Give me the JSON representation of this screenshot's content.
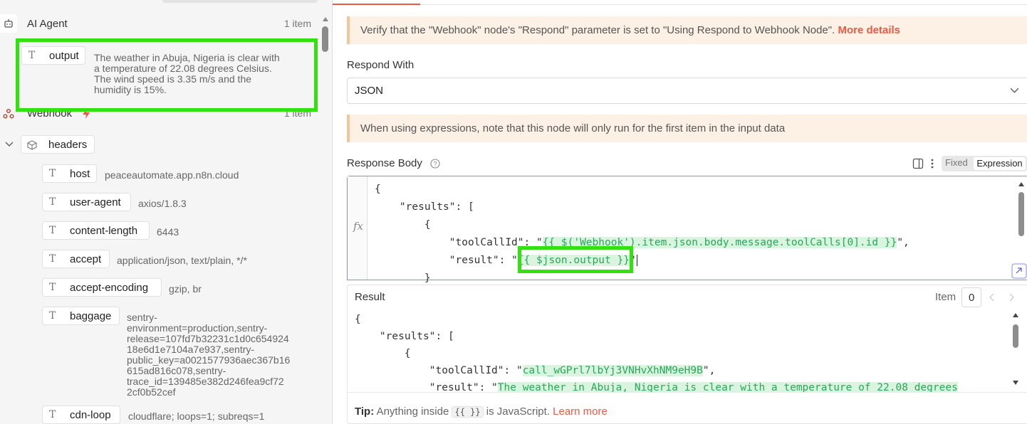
{
  "left_panel": {
    "ai_agent_node": {
      "label": "AI Agent",
      "count": "1 item"
    },
    "output_field": {
      "key": "output",
      "value_lines": [
        "The weather in Abuja, Nigeria is clear with",
        "a temperature of 22.08 degrees Celsius.",
        "The wind speed is 3.35 m/s and the",
        "humidity is 15%."
      ]
    },
    "webhook_node": {
      "label": "Webhook",
      "count": "1 item"
    },
    "headers_field": {
      "key": "headers"
    },
    "header_items": [
      {
        "key": "host",
        "value_lines": [
          "peaceautomate.app.n8n.cloud"
        ]
      },
      {
        "key": "user-agent",
        "value_lines": [
          "axios/1.8.3"
        ]
      },
      {
        "key": "content-length",
        "value_lines": [
          "6443"
        ]
      },
      {
        "key": "accept",
        "value_lines": [
          "application/json, text/plain, */*"
        ]
      },
      {
        "key": "accept-encoding",
        "value_lines": [
          "gzip, br"
        ]
      },
      {
        "key": "baggage",
        "value_lines": [
          "sentry-",
          "environment=production,sentry-",
          "release=107fd7b32231c1d0c654924",
          "18e6d1e7104a7e937,sentry-",
          "public_key=a0021577936aec367b16",
          "615ad816c078,sentry-",
          "trace_id=139485e382d246fea9cf72",
          "2cf0b52cef"
        ]
      },
      {
        "key": "cdn-loop",
        "value_lines": [
          "cloudflare; loops=1; subreqs=1"
        ]
      }
    ]
  },
  "right_panel": {
    "warning_1": {
      "text": "Verify that the \"Webhook\" node's \"Respond\" parameter is set to \"Using Respond to Webhook Node\".",
      "link": "More details"
    },
    "respond_with": {
      "label": "Respond With",
      "value": "JSON"
    },
    "warning_2": {
      "text": "When using expressions, note that this node will only run for the first item in the input data"
    },
    "response_body": {
      "label": "Response Body",
      "mode_fixed": "Fixed",
      "mode_expression": "Expression"
    },
    "editor": {
      "fx": "fx",
      "lines": [
        "{",
        "    \"results\": [",
        "        {",
        "            \"toolCallId\": \"",
        "            \"result\": \"",
        "        }"
      ],
      "toolcall_expr": "{{ $('Webhook').item.json.body.message.toolCalls[0].id }}",
      "toolcall_tail": "\",",
      "result_expr": "{{ $json.output }}",
      "result_tail": "\""
    },
    "result": {
      "label": "Result",
      "item_label": "Item",
      "item_value": "0",
      "lines": [
        "{",
        "    \"results\": [",
        "        {",
        "            \"toolCallId\": \"",
        "            \"result\": \""
      ],
      "toolcall_value": "call_wGPrl7lbYj3VNHvXhNM9eH9B",
      "toolcall_tail": "\",",
      "result_value": "The weather in Abuja, Nigeria is clear with a temperature of 22.08 degrees"
    },
    "tip": {
      "bold": "Tip:",
      "text_before": "Anything inside",
      "chip": "{{ }}",
      "text_after": "is JavaScript.",
      "link": "Learn more"
    }
  },
  "colors": {
    "accent": "#ea5a45",
    "highlight_box": "#33e010",
    "expr_green": "#2aa75a",
    "warning_bg": "#fcf1e4"
  },
  "icons": [
    "robot-icon",
    "text-type-icon",
    "webhook-icon",
    "lightning-icon",
    "chevron-down-icon",
    "cube-icon",
    "help-icon",
    "split-panel-icon",
    "more-vertical-icon",
    "chevron-left-icon",
    "chevron-right-icon"
  ]
}
